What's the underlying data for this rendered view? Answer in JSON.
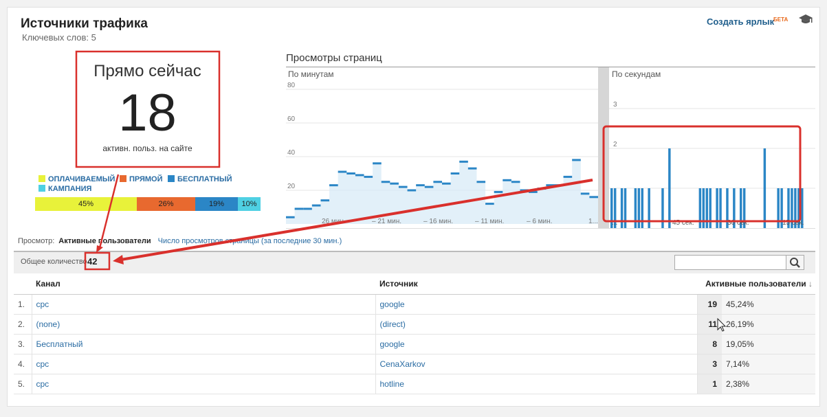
{
  "header": {
    "title": "Источники трафика",
    "subtitle": "Ключевых слов: 5",
    "shortcut_label": "Создать ярлык",
    "beta_badge": "БЕТА"
  },
  "realtime": {
    "label": "Прямо сейчас",
    "count": "18",
    "caption": "активн. польз. на сайте"
  },
  "legend": {
    "paid": "ОПЛАЧИВАЕМЫЙ",
    "direct": "ПРЯМОЙ",
    "free": "БЕСПЛАТНЫЙ",
    "campaign": "КАМПАНИЯ"
  },
  "share_bar": [
    {
      "label": "45%",
      "value": 45,
      "color": "#e8f23a"
    },
    {
      "label": "26%",
      "value": 26,
      "color": "#e8692f"
    },
    {
      "label": "19%",
      "value": 19,
      "color": "#2b86c6"
    },
    {
      "label": "10%",
      "value": 10,
      "color": "#4fd0e3"
    }
  ],
  "pageviews": {
    "title": "Просмотры страниц",
    "minutes_label": "По минутам",
    "seconds_label": "По секундам",
    "minutes_y_ticks": [
      "80",
      "60",
      "40",
      "20"
    ],
    "minutes_x_ticks": [
      "26 мин.",
      "– 21 мин.",
      "– 16 мин.",
      "– 11 мин.",
      "– 6 мин.",
      "1..."
    ],
    "seconds_y_ticks": [
      "3",
      "2"
    ],
    "seconds_x_ticks": [
      "...",
      "45 сек.",
      "30 сек.",
      "15 сек."
    ]
  },
  "chart_data": [
    {
      "type": "line",
      "title": "По минутам",
      "ylim": [
        0,
        80
      ],
      "y_ticks": [
        20,
        40,
        60,
        80
      ],
      "x_ticks": [
        "26 мин.",
        "– 21 мин.",
        "– 16 мин.",
        "– 11 мин.",
        "– 6 мин.",
        "1..."
      ],
      "values": [
        4,
        9,
        9,
        11,
        14,
        23,
        31,
        30,
        29,
        28,
        36,
        25,
        24,
        22,
        20,
        23,
        22,
        25,
        24,
        30,
        37,
        33,
        25,
        12,
        19,
        26,
        25,
        20,
        19,
        21,
        23,
        23,
        28,
        38,
        18,
        16
      ],
      "color": "#2b86c6"
    },
    {
      "type": "bar",
      "title": "По секундам",
      "ylim": [
        0,
        3
      ],
      "y_ticks": [
        2,
        3
      ],
      "x_ticks": [
        "...",
        "45 сек.",
        "30 сек.",
        "15 сек."
      ],
      "values": [
        1,
        1,
        0,
        1,
        1,
        0,
        0,
        1,
        1,
        1,
        0,
        1,
        0,
        0,
        0,
        1,
        0,
        2,
        0,
        0,
        0,
        0,
        0,
        0,
        0,
        0,
        1,
        1,
        1,
        1,
        0,
        1,
        1,
        0,
        1,
        0,
        1,
        0,
        1,
        1,
        0,
        0,
        0,
        0,
        0,
        2,
        0,
        0,
        0,
        1,
        1,
        0,
        1,
        1,
        1,
        1,
        1
      ],
      "color": "#2b86c6"
    }
  ],
  "view_switch": {
    "label": "Просмотр:",
    "active": "Активные пользователи",
    "alt": "Число просмотров страницы (за последние 30 мин.)"
  },
  "totals": {
    "label": "Общее количество",
    "value": "42"
  },
  "table": {
    "headers": {
      "channel": "Канал",
      "source": "Источник",
      "active": "Активные пользователи"
    },
    "rows": [
      {
        "n": "1.",
        "channel": "cpc",
        "source": "google",
        "count": "19",
        "pct": "45,24%"
      },
      {
        "n": "2.",
        "channel": "(none)",
        "source": "(direct)",
        "count": "11",
        "pct": "26,19%"
      },
      {
        "n": "3.",
        "channel": "Бесплатный",
        "source": "google",
        "count": "8",
        "pct": "19,05%"
      },
      {
        "n": "4.",
        "channel": "cpc",
        "source": "CenaXarkov",
        "count": "3",
        "pct": "7,14%"
      },
      {
        "n": "5.",
        "channel": "cpc",
        "source": "hotline",
        "count": "1",
        "pct": "2,38%"
      }
    ]
  }
}
